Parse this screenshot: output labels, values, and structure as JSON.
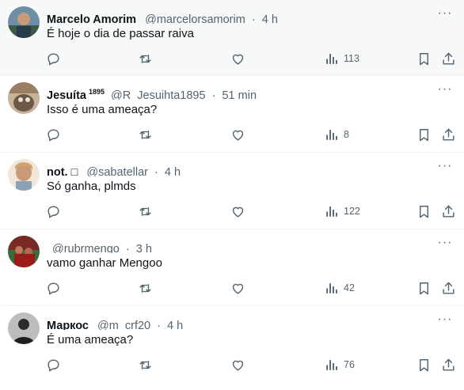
{
  "tweets": [
    {
      "name": "Marcelo Amorim",
      "superscript": "",
      "handle": "@marcelorsamorim",
      "separator": "·",
      "time": "4 h",
      "text": "É hoje o dia de passar raiva",
      "views": "113",
      "avatar_color": "#2f4f6f"
    },
    {
      "name": "Jesuíta",
      "superscript": "1895",
      "handle": "@R_Jesuihta1895",
      "separator": "·",
      "time": "51 min",
      "text": "Isso é uma ameaça?",
      "views": "8",
      "avatar_color": "#8a6b5a"
    },
    {
      "name": "not. □",
      "superscript": "",
      "handle": "@sabatellar",
      "separator": "·",
      "time": "4 h",
      "text": "Só ganha, plmds",
      "views": "122",
      "avatar_color": "#d9b99b"
    },
    {
      "name": "",
      "superscript": "",
      "handle": "@rubrmengo",
      "separator": "·",
      "time": "3 h",
      "text": "vamo ganhar Mengoo",
      "views": "42",
      "avatar_color": "#7a3a32"
    },
    {
      "name": "Маркос",
      "superscript": "",
      "handle": "@m_crf20",
      "separator": "·",
      "time": "4 h",
      "text": "É uma ameaça?",
      "views": "76",
      "avatar_color": "#2a2a2a"
    }
  ],
  "icons": {
    "more": "more-icon",
    "reply": "reply-icon",
    "retweet": "retweet-icon",
    "like": "like-icon",
    "views": "views-icon",
    "bookmark": "bookmark-icon",
    "share": "share-icon"
  }
}
